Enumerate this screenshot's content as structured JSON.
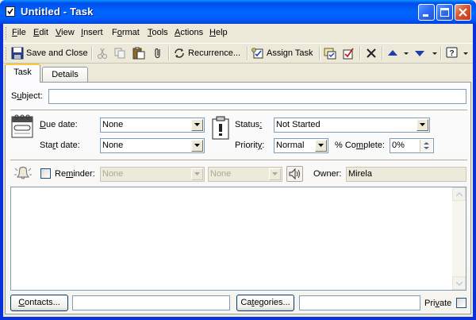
{
  "window": {
    "title": "Untitled - Task"
  },
  "menu": {
    "items": [
      {
        "u": "F",
        "rest": "ile"
      },
      {
        "u": "E",
        "rest": "dit"
      },
      {
        "u": "V",
        "rest": "iew"
      },
      {
        "u": "I",
        "rest": "nsert"
      },
      {
        "pre": "F",
        "u": "o",
        "rest": "rmat"
      },
      {
        "u": "T",
        "rest": "ools"
      },
      {
        "u": "A",
        "rest": "ctions"
      },
      {
        "u": "H",
        "rest": "elp"
      }
    ]
  },
  "toolbar": {
    "save_close": "Save and Close",
    "save_close_ul": "S",
    "save_close_rest": "ave and Close",
    "recurrence_pre": "Re",
    "recurrence_ul": "c",
    "recurrence_rest": "urrence...",
    "assign_pre": "Assi",
    "assign_ul": "g",
    "assign_rest": "n Task"
  },
  "tabs": [
    {
      "label": "Task",
      "active": true
    },
    {
      "label": "Details",
      "active": false
    }
  ],
  "form": {
    "subject_ul": "u",
    "subject_pre": "S",
    "subject_rest": "bject:",
    "subject_value": "",
    "due_ul": "D",
    "due_rest": "ue date:",
    "due_value": "None",
    "start_pre": "Sta",
    "start_ul": "r",
    "start_rest": "t date:",
    "start_value": "None",
    "status_pre": "Status",
    "status_ul": ":",
    "status_value": "Not Started",
    "priority_pre": "Priorit",
    "priority_ul": "y",
    "priority_rest": ":",
    "priority_value": "Normal",
    "complete_pre": "% Co",
    "complete_ul": "m",
    "complete_rest": "plete:",
    "complete_value": "0%",
    "reminder_pre": "Re",
    "reminder_ul": "m",
    "reminder_rest": "inder:",
    "reminder_date": "None",
    "reminder_time": "None",
    "reminder_checked": false,
    "owner_label": "Owner:",
    "owner_value": "Mirela",
    "notes_value": ""
  },
  "footer": {
    "contacts_ul": "C",
    "contacts_rest": "ontacts...",
    "contacts_value": "",
    "categories_pre": "Ca",
    "categories_ul": "t",
    "categories_rest": "egories...",
    "categories_value": "",
    "private_pre": "Pri",
    "private_ul": "v",
    "private_rest": "ate",
    "private_checked": false
  },
  "colors": {
    "titlebar": "#0054e3",
    "face": "#ece9d8",
    "field_border": "#7f9db9",
    "tab_highlight": "#ffc83c"
  }
}
